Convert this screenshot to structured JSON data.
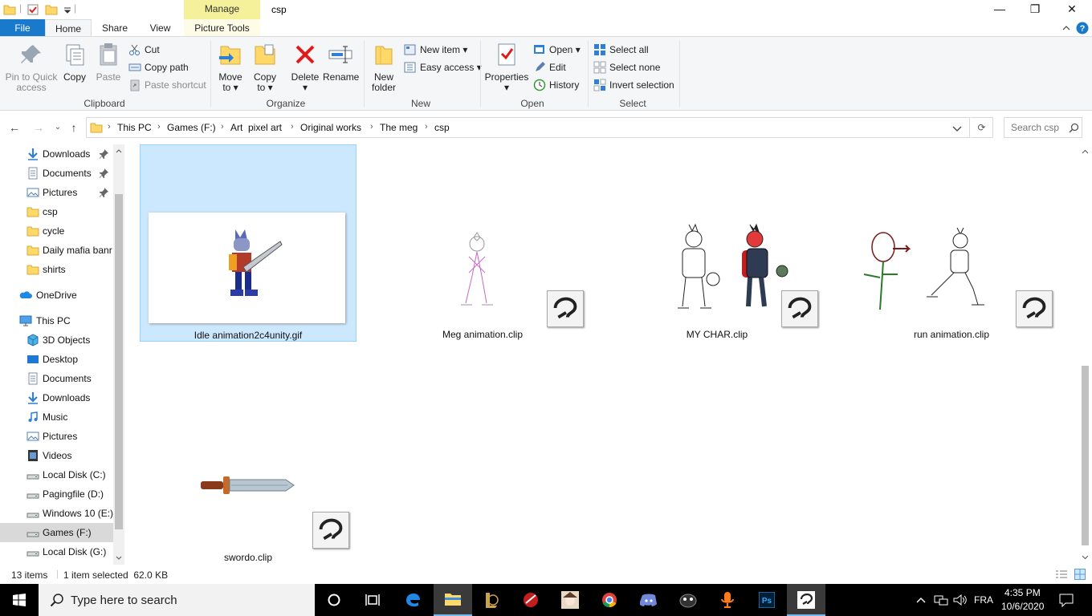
{
  "window": {
    "title": "csp",
    "contextual_tab": "Manage",
    "controls": {
      "minimize": "—",
      "maximize": "❐",
      "close": "✕"
    }
  },
  "ribbon_tabs": [
    "File",
    "Home",
    "Share",
    "View",
    "Picture Tools"
  ],
  "ribbon": {
    "clipboard": {
      "label": "Clipboard",
      "pin": "Pin to Quick access",
      "pin_line1": "Pin to Quick",
      "pin_line2": "access",
      "copy": "Copy",
      "paste": "Paste",
      "cut": "Cut",
      "copy_path": "Copy path",
      "paste_shortcut": "Paste shortcut"
    },
    "organize": {
      "label": "Organize",
      "move_to_l1": "Move",
      "move_to_l2": "to",
      "copy_to_l1": "Copy",
      "copy_to_l2": "to",
      "delete": "Delete",
      "rename": "Rename"
    },
    "new": {
      "label": "New",
      "new_folder_l1": "New",
      "new_folder_l2": "folder",
      "new_item": "New item",
      "easy_access": "Easy access"
    },
    "open": {
      "label": "Open",
      "properties": "Properties",
      "open": "Open",
      "edit": "Edit",
      "history": "History"
    },
    "select": {
      "label": "Select",
      "select_all": "Select all",
      "select_none": "Select none",
      "invert": "Invert selection"
    }
  },
  "address": {
    "breadcrumbs": [
      "This PC",
      "Games (F:)",
      "Art  pixel art",
      "Original works",
      "The meg",
      "csp"
    ],
    "search_placeholder": "Search csp"
  },
  "nav_pane": [
    {
      "label": "Downloads",
      "icon": "download-icon",
      "pinned": true
    },
    {
      "label": "Documents",
      "icon": "documents-icon",
      "pinned": true
    },
    {
      "label": "Pictures",
      "icon": "pictures-icon",
      "pinned": true
    },
    {
      "label": "csp",
      "icon": "folder-icon",
      "pinned": false
    },
    {
      "label": "cycle",
      "icon": "folder-icon",
      "pinned": false
    },
    {
      "label": "Daily mafia banr",
      "icon": "folder-icon",
      "pinned": false
    },
    {
      "label": "shirts",
      "icon": "folder-icon",
      "pinned": false
    },
    {
      "label": "OneDrive",
      "icon": "cloud-icon",
      "pinned": false
    },
    {
      "label": "This PC",
      "icon": "computer-icon",
      "pinned": false
    },
    {
      "label": "3D Objects",
      "icon": "cube-icon",
      "pinned": false
    },
    {
      "label": "Desktop",
      "icon": "desktop-icon",
      "pinned": false
    },
    {
      "label": "Documents",
      "icon": "documents-icon",
      "pinned": false
    },
    {
      "label": "Downloads",
      "icon": "download-icon",
      "pinned": false
    },
    {
      "label": "Music",
      "icon": "music-icon",
      "pinned": false
    },
    {
      "label": "Pictures",
      "icon": "pictures-icon",
      "pinned": false
    },
    {
      "label": "Videos",
      "icon": "videos-icon",
      "pinned": false
    },
    {
      "label": "Local Disk (C:)",
      "icon": "drive-icon",
      "pinned": false
    },
    {
      "label": "Pagingfile (D:)",
      "icon": "drive-icon",
      "pinned": false
    },
    {
      "label": "Windows 10 (E:)",
      "icon": "drive-icon",
      "pinned": false
    },
    {
      "label": "Games (F:)",
      "icon": "drive-icon",
      "pinned": false,
      "selected": true
    },
    {
      "label": "Local Disk (G:)",
      "icon": "drive-icon",
      "pinned": false
    }
  ],
  "files": [
    {
      "name": "Idle animation2c4unity.gif",
      "selected": true
    },
    {
      "name": "Meg animation.clip"
    },
    {
      "name": "MY CHAR.clip"
    },
    {
      "name": "run animation.clip"
    },
    {
      "name": "swordo.clip"
    }
  ],
  "status": {
    "item_count": "13 items",
    "selection": "1 item selected  62.0 KB"
  },
  "taskbar": {
    "search_placeholder": "Type here to search",
    "language": "FRA",
    "time": "4:35 PM",
    "date": "10/6/2020"
  },
  "colors": {
    "accent": "#1979ca",
    "selection_bg": "#cce8ff",
    "selection_border": "#99d1ff",
    "manage_tab": "#f5f09a",
    "folder_yellow": "#ffd86a"
  }
}
